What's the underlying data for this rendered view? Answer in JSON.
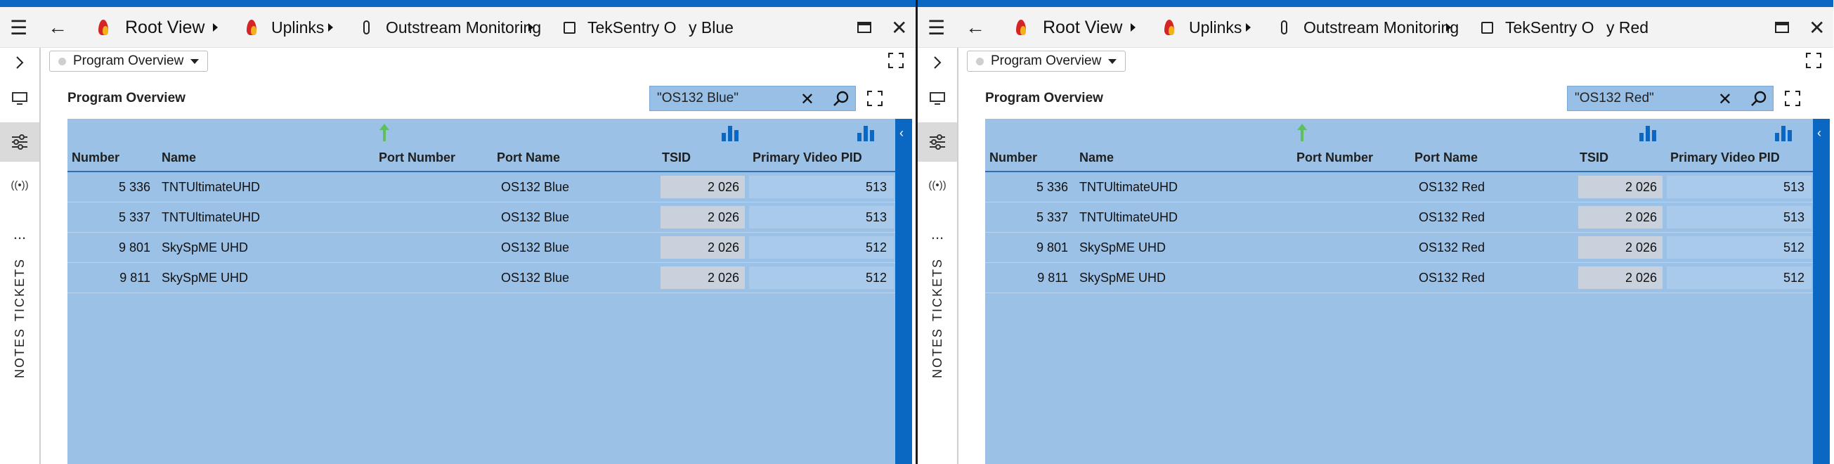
{
  "panes": [
    {
      "breadcrumb": [
        {
          "label": "Root View",
          "icon": "flame-icon"
        },
        {
          "label": "Uplinks",
          "icon": "flame-icon"
        },
        {
          "label": "Outstream Monitoring",
          "icon": "pill-icon"
        },
        {
          "label": "TekSentry O",
          "icon": "square-icon"
        },
        {
          "label": "y Blue"
        }
      ],
      "view_selector": "Program Overview",
      "section_title": "Program Overview",
      "search_value": "\"OS132 Blue\"",
      "columns": [
        "Number",
        "Name",
        "Port Number",
        "Port Name",
        "TSID",
        "Primary Video PID"
      ],
      "rows": [
        {
          "number": "5 336",
          "name": "TNTUltimateUHD",
          "port_number": "",
          "port_name": "OS132 Blue",
          "tsid": "2 026",
          "pid": "513"
        },
        {
          "number": "5 337",
          "name": "TNTUltimateUHD",
          "port_number": "",
          "port_name": "OS132 Blue",
          "tsid": "2 026",
          "pid": "513"
        },
        {
          "number": "9 801",
          "name": "SkySpME UHD",
          "port_number": "",
          "port_name": "OS132 Blue",
          "tsid": "2 026",
          "pid": "512"
        },
        {
          "number": "9 811",
          "name": "SkySpME UHD",
          "port_number": "",
          "port_name": "OS132 Blue",
          "tsid": "2 026",
          "pid": "512"
        }
      ]
    },
    {
      "breadcrumb": [
        {
          "label": "Root View",
          "icon": "flame-icon"
        },
        {
          "label": "Uplinks",
          "icon": "flame-icon"
        },
        {
          "label": "Outstream Monitoring",
          "icon": "pill-icon"
        },
        {
          "label": "TekSentry O",
          "icon": "square-icon"
        },
        {
          "label": "y Red"
        }
      ],
      "view_selector": "Program Overview",
      "section_title": "Program Overview",
      "search_value": "\"OS132 Red\"",
      "columns": [
        "Number",
        "Name",
        "Port Number",
        "Port Name",
        "TSID",
        "Primary Video PID"
      ],
      "rows": [
        {
          "number": "5 336",
          "name": "TNTUltimateUHD",
          "port_number": "",
          "port_name": "OS132 Red",
          "tsid": "2 026",
          "pid": "513"
        },
        {
          "number": "5 337",
          "name": "TNTUltimateUHD",
          "port_number": "",
          "port_name": "OS132 Red",
          "tsid": "2 026",
          "pid": "513"
        },
        {
          "number": "9 801",
          "name": "SkySpME UHD",
          "port_number": "",
          "port_name": "OS132 Red",
          "tsid": "2 026",
          "pid": "512"
        },
        {
          "number": "9 811",
          "name": "SkySpME UHD",
          "port_number": "",
          "port_name": "OS132 Red",
          "tsid": "2 026",
          "pid": "512"
        }
      ]
    }
  ],
  "sidebar": {
    "tickets_label": "TICKETS",
    "notes_label": "NOTES",
    "more_label": "..."
  },
  "colors": {
    "accent": "#0a67c2",
    "grid_bg": "#9bc1e6",
    "search_bg": "#98bfe6",
    "tsid_bg": "#c9d2dc"
  }
}
